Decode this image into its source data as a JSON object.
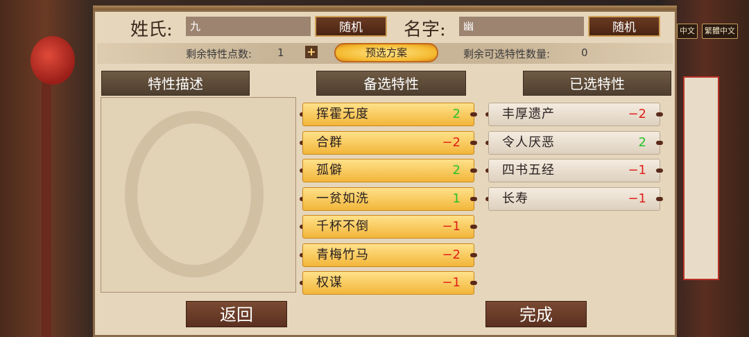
{
  "language_buttons": [
    "中文",
    "繁體中文"
  ],
  "header": {
    "surname_label": "姓氏:",
    "surname_value": "九",
    "surname_random": "随机",
    "givenname_label": "名字:",
    "givenname_value": "幽",
    "givenname_random": "随机"
  },
  "info": {
    "remaining_points_label": "剩余特性点数:",
    "remaining_points_value": "1",
    "plus_icon": "+",
    "preset_label": "预选方案",
    "remaining_selectable_label": "剩余可选特性数量:",
    "remaining_selectable_value": "0"
  },
  "tabs": {
    "description": "特性描述",
    "available": "备选特性",
    "selected": "已选特性"
  },
  "available_traits": [
    {
      "name": "挥霍无度",
      "value": "2",
      "sign": "pos"
    },
    {
      "name": "合群",
      "value": "−2",
      "sign": "neg"
    },
    {
      "name": "孤僻",
      "value": "2",
      "sign": "pos"
    },
    {
      "name": "一贫如洗",
      "value": "1",
      "sign": "pos"
    },
    {
      "name": "千杯不倒",
      "value": "−1",
      "sign": "neg"
    },
    {
      "name": "青梅竹马",
      "value": "−2",
      "sign": "neg"
    },
    {
      "name": "权谋",
      "value": "−1",
      "sign": "neg"
    }
  ],
  "selected_traits": [
    {
      "name": "丰厚遗产",
      "value": "−2",
      "sign": "neg"
    },
    {
      "name": "令人厌恶",
      "value": "2",
      "sign": "pos"
    },
    {
      "name": "四书五经",
      "value": "−1",
      "sign": "neg"
    },
    {
      "name": "长寿",
      "value": "−1",
      "sign": "neg"
    }
  ],
  "footer": {
    "back": "返回",
    "done": "完成"
  }
}
